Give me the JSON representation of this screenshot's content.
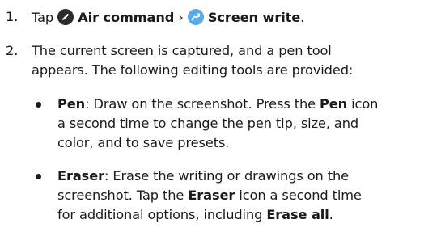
{
  "step1": {
    "number": "1.",
    "tap": "Tap",
    "air_command_icon": "air-command-icon",
    "air_command": "Air command",
    "separator": "›",
    "screen_write_icon": "screen-write-icon",
    "screen_write": "Screen write",
    "end": "."
  },
  "step2": {
    "number": "2.",
    "line1": "The current screen is captured, and a pen tool",
    "line2": "appears. The following editing tools are provided:"
  },
  "bullets": {
    "pen": {
      "term": "Pen",
      "l1_a": ": Draw on the screenshot. Press the ",
      "l1_b": "Pen",
      "l1_c": " icon",
      "line2": "a second time to change the pen tip, size, and",
      "line3": "color, and to save presets."
    },
    "eraser": {
      "term": "Eraser",
      "l1_a": ": Erase the writing or drawings on the",
      "line2": "screenshot. Tap the ",
      "line2_bold": "Eraser",
      "line2_end": " icon a second time",
      "line3": "for additional options, including ",
      "line3_bold": "Erase all",
      "line3_end": "."
    }
  },
  "colors": {
    "text": "#1a1a1a",
    "air_command_icon_bg": "#2b2b2b",
    "screen_write_icon_bg": "#5aa9ea"
  }
}
